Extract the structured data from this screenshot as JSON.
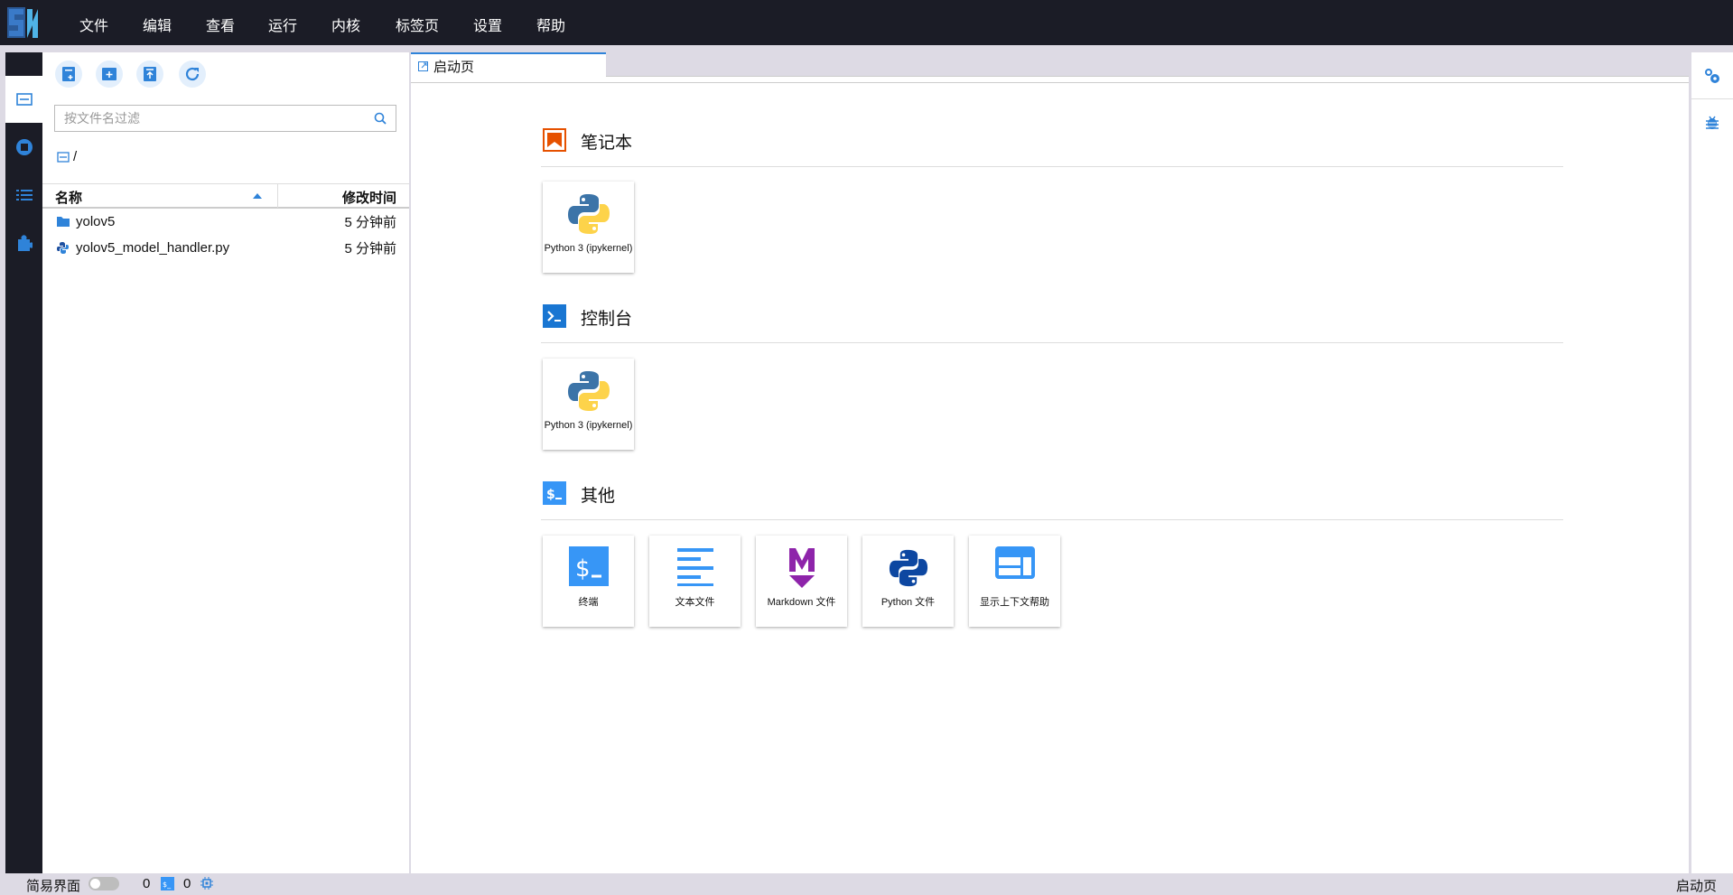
{
  "menu": [
    "文件",
    "编辑",
    "查看",
    "运行",
    "内核",
    "标签页",
    "设置",
    "帮助"
  ],
  "filebrowser": {
    "filter_placeholder": "按文件名过滤",
    "path": "/",
    "col_name": "名称",
    "col_modified": "修改时间",
    "files": [
      {
        "name": "yolov5",
        "modified": "5 分钟前",
        "type": "folder"
      },
      {
        "name": "yolov5_model_handler.py",
        "modified": "5 分钟前",
        "type": "python"
      }
    ]
  },
  "tab": {
    "label": "启动页"
  },
  "launcher": {
    "notebook": {
      "title": "笔记本",
      "cards": [
        {
          "label": "Python 3 (ipykernel)"
        }
      ]
    },
    "console": {
      "title": "控制台",
      "cards": [
        {
          "label": "Python 3 (ipykernel)"
        }
      ]
    },
    "other": {
      "title": "其他",
      "cards": [
        {
          "label": "终端"
        },
        {
          "label": "文本文件"
        },
        {
          "label": "Markdown 文件"
        },
        {
          "label": "Python 文件"
        },
        {
          "label": "显示上下文帮助"
        }
      ]
    }
  },
  "status": {
    "simple_mode": "简易界面",
    "kernels": "0",
    "terminals": "0",
    "right_label": "启动页"
  },
  "colors": {
    "accent": "#2f83d9",
    "topbar": "#1b1c26",
    "notebook": "#e65100",
    "console": "#1976d2"
  }
}
